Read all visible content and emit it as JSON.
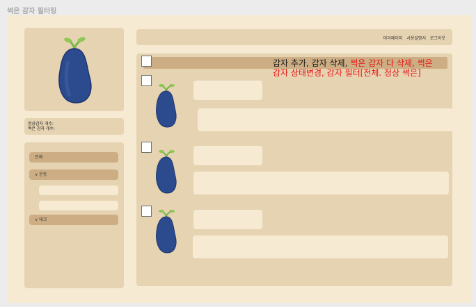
{
  "app": {
    "title": "썩은 감자 필터링"
  },
  "sidebar": {
    "count": {
      "normal_label": "정상감자 개수:",
      "rotten_label": "썩은 감자 개수:"
    },
    "nav": {
      "all": "전체",
      "exercise": "∨ 운동",
      "tech": "∨ 테크"
    }
  },
  "header": {
    "links": [
      "마이페이지",
      "사용설명서",
      "로그아웃"
    ]
  },
  "annotation": {
    "black_part": "감자 추가, 감자 삭제, ",
    "red_part_1": "썩은 감자 다 삭제, 썩은",
    "red_part_2": "감자 상태변경, 감자 필터[전체. 정상 썩은]"
  },
  "colors": {
    "background": "#ececec",
    "canvas": "#f6ead2",
    "panel": "#e6d3b2",
    "accent": "#cdae84",
    "potato": "#2c4a8e",
    "annotation_red": "#e81515"
  },
  "icons": {
    "logo": "potato-icon",
    "item": "potato-icon"
  }
}
